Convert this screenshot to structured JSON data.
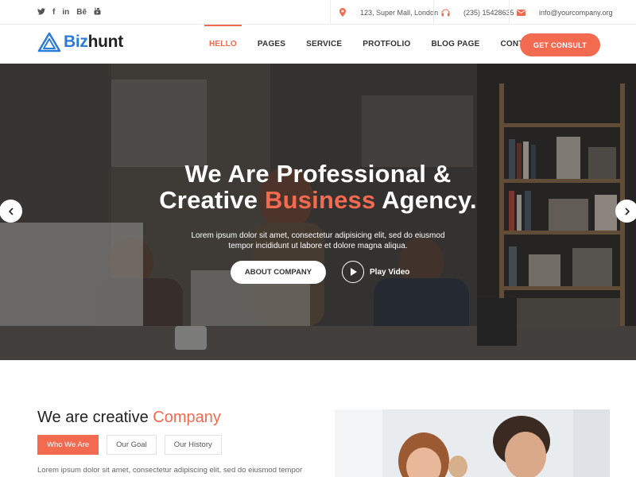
{
  "topbar": {
    "social": [
      {
        "icon": "twitter-icon",
        "glyph": "🐦"
      },
      {
        "icon": "facebook-icon",
        "glyph": "f"
      },
      {
        "icon": "linkedin-icon",
        "glyph": "in"
      },
      {
        "icon": "behance-icon",
        "glyph": "Bē"
      },
      {
        "icon": "youtube-icon",
        "glyph": "▶"
      }
    ],
    "address": "123, Super Mall, London",
    "phone": "(235) 15428635",
    "email": "info@yourcompany.org"
  },
  "header": {
    "logo_prefix": "Biz",
    "logo_suffix": "hunt",
    "nav": [
      "HELLO",
      "PAGES",
      "SERVICE",
      "PROTFOLIO",
      "BLOG PAGE",
      "CONTACT"
    ],
    "active_nav": "HELLO",
    "cta_label": "GET CONSULT"
  },
  "hero": {
    "title_line1": "We Are Professional &",
    "title_line2_pre": "Creative ",
    "title_line2_accent": "Business",
    "title_line2_post": " Agency.",
    "subtitle_line1": "Lorem ipsum dolor sit amet, consectetur adipisicing elit, sed do eiusmod",
    "subtitle_line2": "tempor incididunt ut labore et dolore magna aliqua.",
    "about_button": "ABOUT COMPANY",
    "play_label": "Play Video"
  },
  "about": {
    "title_pre": "We are creative ",
    "title_accent": "Company",
    "tabs": [
      "Who We Are",
      "Our Goal",
      "Our History"
    ],
    "active_tab": "Who We Are",
    "text": "Lorem ipsum dolor sit amet, consectetur adipiscing elit, sed do eiusmod tempor"
  },
  "colors": {
    "accent": "#f26a4f",
    "logo_blue": "#2b7bd8"
  }
}
